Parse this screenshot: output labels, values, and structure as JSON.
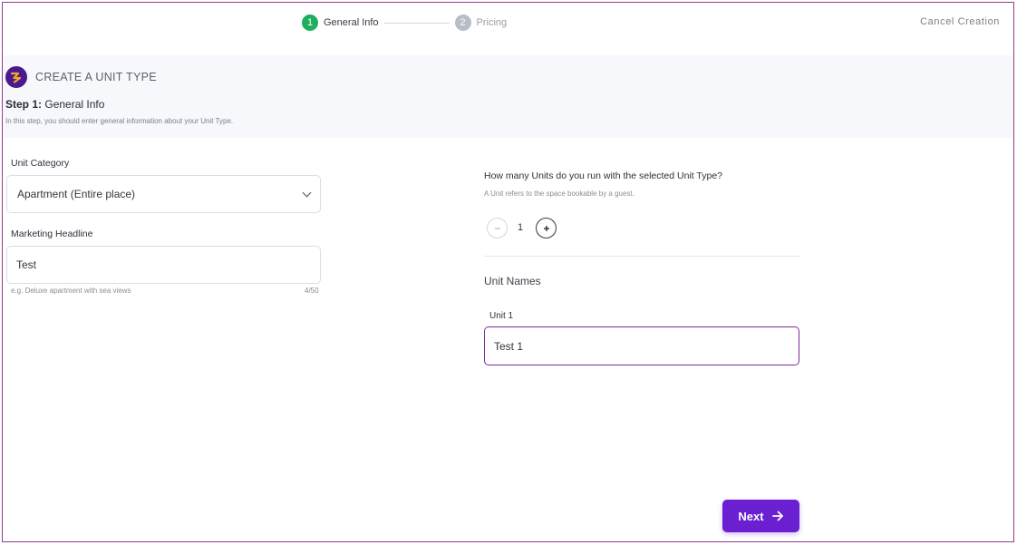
{
  "stepper": {
    "steps": [
      {
        "number": "1",
        "label": "General Info",
        "state": "active"
      },
      {
        "number": "2",
        "label": "Pricing",
        "state": "inactive"
      }
    ],
    "cancel_label": "Cancel Creation"
  },
  "header": {
    "logo_icon": "brand-logo-icon",
    "title": "CREATE A UNIT TYPE",
    "step_prefix": "Step 1:",
    "step_title": "General Info",
    "description": "In this step, you should enter general information about your Unit Type."
  },
  "left_form": {
    "unit_category": {
      "label": "Unit Category",
      "value": "Apartment (Entire place)"
    },
    "marketing_headline": {
      "label": "Marketing Headline",
      "value": "Test",
      "hint": "e.g. Deluxe apartment with sea views",
      "counter": "4/50"
    }
  },
  "right_form": {
    "question": "How many Units do you run with the selected Unit Type?",
    "question_hint": "A Unit refers to the space bookable by a guest.",
    "unit_count": "1",
    "minus_icon": "minus-icon",
    "plus_icon": "plus-icon",
    "unit_names_title": "Unit Names",
    "units": [
      {
        "label": "Unit 1",
        "value": "Test 1"
      }
    ]
  },
  "footer": {
    "next_label": "Next",
    "next_icon": "arrow-right-icon"
  },
  "colors": {
    "accent": "#6a1fd1",
    "active_step": "#1fae5e",
    "frame": "#8e3d8c",
    "brand": "#4a1a8f"
  }
}
